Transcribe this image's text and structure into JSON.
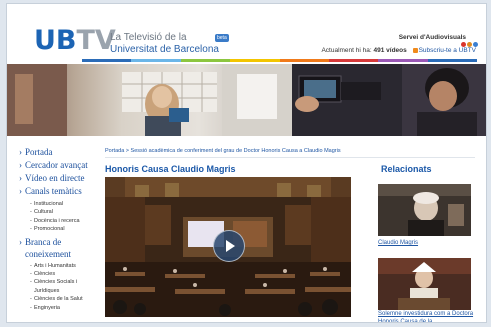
{
  "header": {
    "logo_ub": "UB",
    "logo_tv": "TV",
    "tagline_line1": "La Televisió de la",
    "tagline_line2": "Universitat de Barcelona",
    "beta_badge": "beta",
    "service_label": "Servei d'Audiovisuals",
    "counter_prefix": "Actualment hi ha:",
    "counter_value": "491 vídeos",
    "subscribe_label": "Subscriu-te a UBTV",
    "dot_colors": [
      "#d9342b",
      "#e08a1e",
      "#3b7fd1"
    ],
    "bar_colors": [
      "#2b6cb8",
      "#6bb6e8",
      "#8cc63f",
      "#f2c500",
      "#f07a1a",
      "#d63a3a",
      "#9b59b6",
      "#2b6cb8"
    ]
  },
  "sidebar": {
    "main_items": [
      {
        "label": "Portada"
      },
      {
        "label": "Cercador avançat"
      },
      {
        "label": "Vídeo en directe"
      },
      {
        "label": "Canals temàtics"
      }
    ],
    "channels": [
      "Institucional",
      "Cultural",
      "Docència i recerca",
      "Promocional"
    ],
    "knowledge_label": "Branca de coneixement",
    "knowledge": [
      "Arts i Humanitats",
      "Ciències",
      "Ciències Socials i Jurídiques",
      "Ciències de la Salut",
      "Enginyeria"
    ]
  },
  "main": {
    "breadcrumb_home": "Portada",
    "breadcrumb_sep": ">",
    "breadcrumb_current": "Sessió acadèmica de conferiment del grau de Doctor Honoris Causa a Claudio Magris",
    "video_title": "Honoris Causa Claudio Magris"
  },
  "related": {
    "title": "Relacionats",
    "items": [
      {
        "caption": "Claudio Magris"
      },
      {
        "caption": "Solemne investidura com a Doctora Honoris Causa de la"
      }
    ]
  }
}
